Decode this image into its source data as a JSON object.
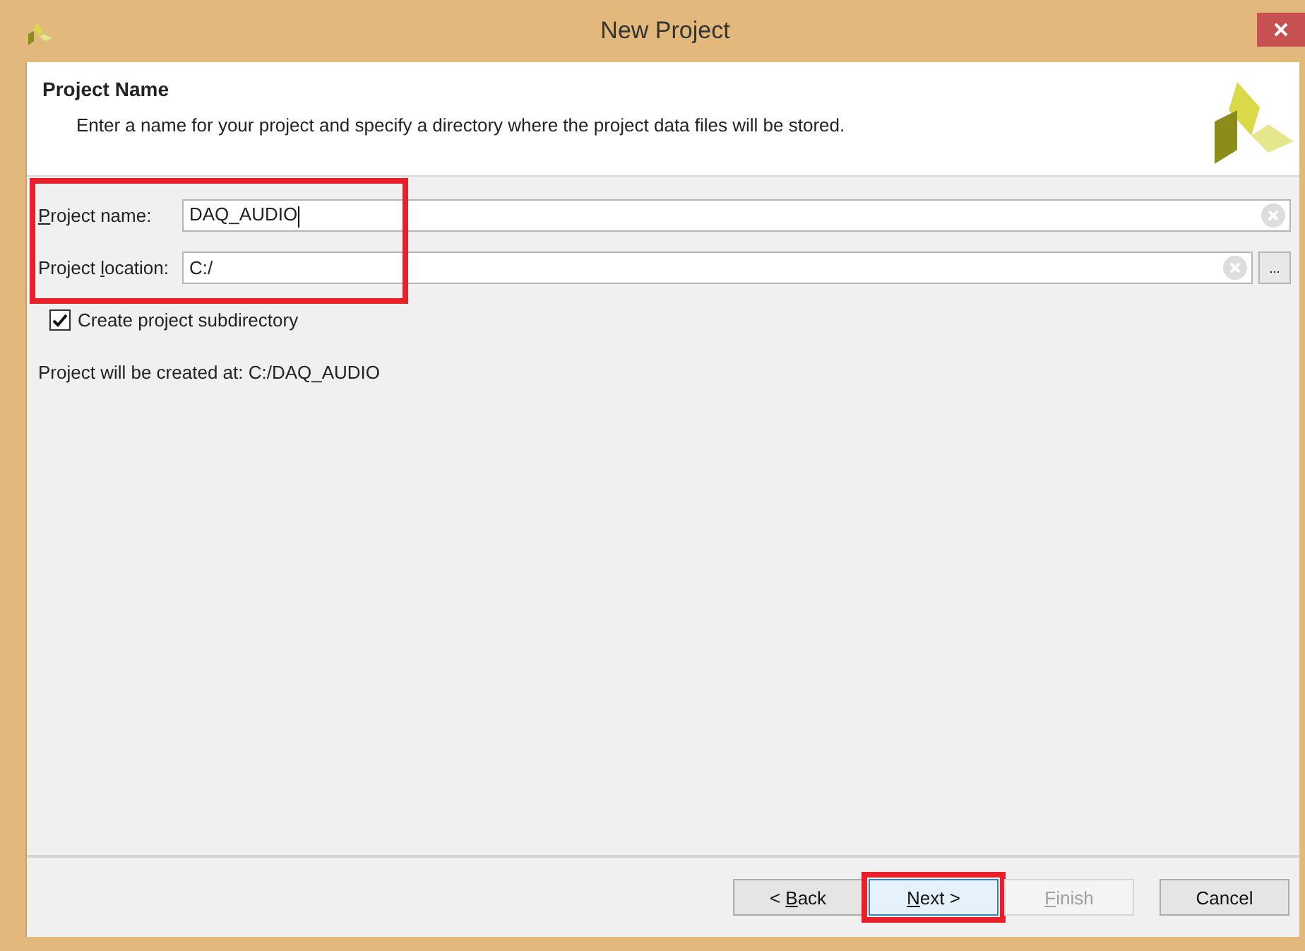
{
  "window": {
    "title": "New Project"
  },
  "header": {
    "title": "Project Name",
    "description": "Enter a name for your project and specify a directory where the project data files will be stored."
  },
  "fields": [
    {
      "label": {
        "key": "P",
        "after": "roject name:"
      },
      "value": "DAQ_AUDIO"
    },
    {
      "label": {
        "before": "Project ",
        "key": "l",
        "after": "ocation:"
      },
      "value": "C:/",
      "browse_label": "..."
    }
  ],
  "fields_highlighted": true,
  "subdirectory": {
    "label": "Create project subdirectory",
    "checked": true
  },
  "summary": "Project will be created at: C:/DAQ_AUDIO",
  "buttons": [
    {
      "label": {
        "before": "< ",
        "key": "B",
        "after": "ack"
      },
      "disabled": false,
      "default": false,
      "highlighted": false
    },
    {
      "label": {
        "key": "N",
        "after": "ext >"
      },
      "disabled": false,
      "default": true,
      "highlighted": true
    },
    {
      "label": {
        "key": "F",
        "after": "inish"
      },
      "disabled": true,
      "default": false,
      "highlighted": false
    },
    {
      "label": {
        "before": "Cancel"
      },
      "disabled": false,
      "default": false,
      "highlighted": false
    }
  ]
}
